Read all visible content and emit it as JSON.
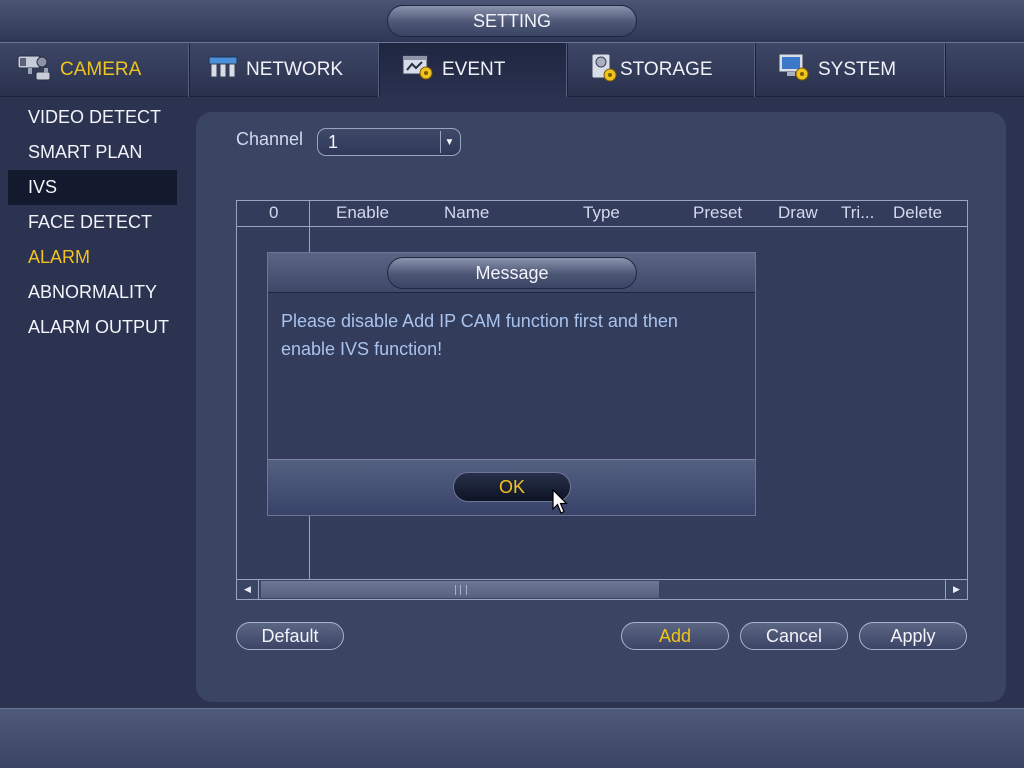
{
  "titlebar": {
    "title": "SETTING"
  },
  "tabs": [
    {
      "label": "CAMERA",
      "icon": "camera-icon",
      "color": "#f0c31f"
    },
    {
      "label": "NETWORK",
      "icon": "network-icon"
    },
    {
      "label": "EVENT",
      "icon": "event-icon"
    },
    {
      "label": "STORAGE",
      "icon": "storage-icon"
    },
    {
      "label": "SYSTEM",
      "icon": "system-icon"
    }
  ],
  "active_tab": "EVENT",
  "sidebar": {
    "items": [
      {
        "label": "VIDEO DETECT"
      },
      {
        "label": "SMART PLAN"
      },
      {
        "label": "IVS",
        "selected": true
      },
      {
        "label": "FACE DETECT"
      },
      {
        "label": "ALARM",
        "color": "#f0c31f"
      },
      {
        "label": "ABNORMALITY"
      },
      {
        "label": "ALARM OUTPUT"
      }
    ]
  },
  "main": {
    "channel_label": "Channel",
    "channel_value": "1",
    "table": {
      "columns": [
        "0",
        "Enable",
        "Name",
        "Type",
        "Preset",
        "Draw",
        "Tri...",
        "Delete"
      ],
      "rows": []
    },
    "buttons": {
      "default": "Default",
      "add": "Add",
      "cancel": "Cancel",
      "apply": "Apply"
    }
  },
  "dialog": {
    "title": "Message",
    "message_line1": "Please disable Add IP CAM function first and then",
    "message_line2": "enable IVS function!",
    "ok": "OK"
  },
  "colors": {
    "accent": "#f0c31f",
    "background": "#2b3350",
    "panel": "#3a4463",
    "message_text": "#a9c3ee"
  }
}
